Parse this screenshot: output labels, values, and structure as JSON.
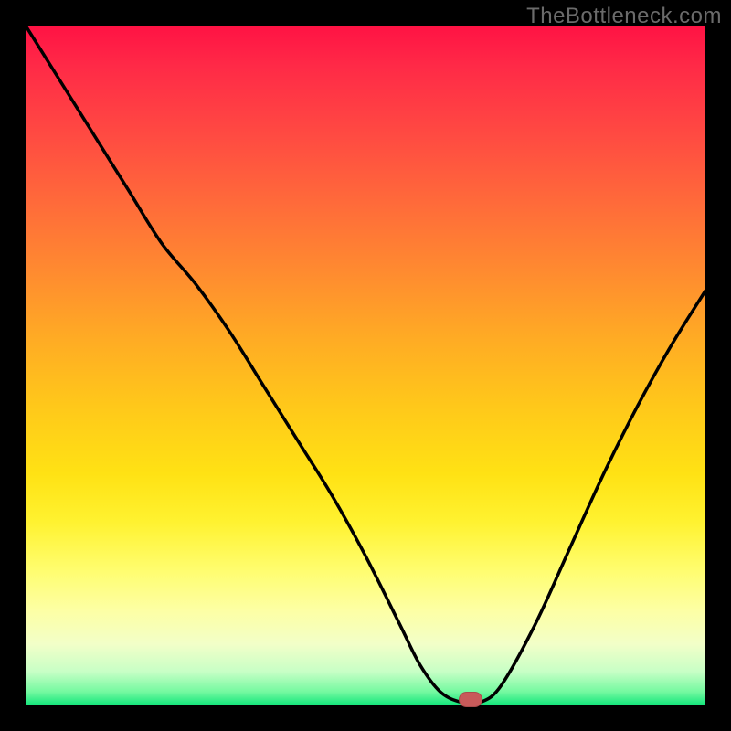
{
  "watermark": "TheBottleneck.com",
  "marker": {
    "x_frac": 0.655,
    "y_frac": 0.991
  },
  "chart_data": {
    "type": "line",
    "title": "",
    "xlabel": "",
    "ylabel": "",
    "xlim": [
      0,
      1
    ],
    "ylim": [
      0,
      1
    ],
    "series": [
      {
        "name": "bottleneck-curve",
        "x": [
          0.0,
          0.05,
          0.1,
          0.15,
          0.2,
          0.25,
          0.3,
          0.35,
          0.4,
          0.45,
          0.5,
          0.55,
          0.58,
          0.61,
          0.64,
          0.67,
          0.7,
          0.75,
          0.8,
          0.85,
          0.9,
          0.95,
          1.0
        ],
        "y": [
          1.0,
          0.92,
          0.84,
          0.76,
          0.68,
          0.62,
          0.55,
          0.47,
          0.39,
          0.31,
          0.22,
          0.12,
          0.06,
          0.02,
          0.005,
          0.005,
          0.03,
          0.12,
          0.23,
          0.34,
          0.44,
          0.53,
          0.61
        ]
      }
    ],
    "annotations": [
      {
        "type": "marker",
        "x": 0.655,
        "y": 0.005,
        "label": "optimal-point"
      }
    ]
  }
}
